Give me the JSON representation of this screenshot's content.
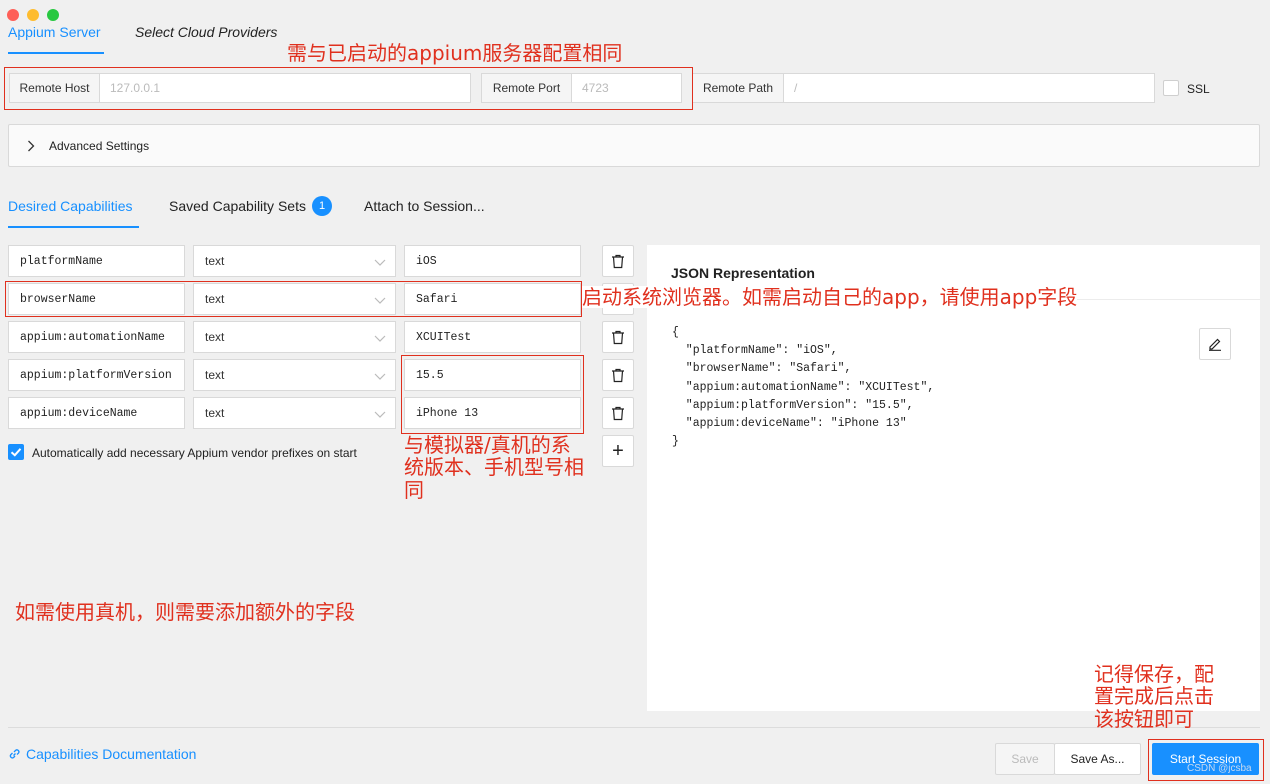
{
  "window": {
    "controls": [
      "close",
      "minimize",
      "maximize"
    ]
  },
  "tabs": {
    "server": "Appium Server",
    "cloud": "Select Cloud Providers"
  },
  "server": {
    "host_label": "Remote Host",
    "host_placeholder": "127.0.0.1",
    "port_label": "Remote Port",
    "port_placeholder": "4723",
    "path_label": "Remote Path",
    "path_placeholder": "/",
    "ssl_label": "SSL"
  },
  "advanced": {
    "label": "Advanced Settings"
  },
  "cap_tabs": {
    "desired": "Desired Capabilities",
    "saved": "Saved Capability Sets",
    "saved_count": "1",
    "attach": "Attach to Session..."
  },
  "capabilities": [
    {
      "name": "platformName",
      "type": "text",
      "value": "iOS"
    },
    {
      "name": "browserName",
      "type": "text",
      "value": "Safari"
    },
    {
      "name": "appium:automationName",
      "type": "text",
      "value": "XCUITest"
    },
    {
      "name": "appium:platformVersion",
      "type": "text",
      "value": "15.5"
    },
    {
      "name": "appium:deviceName",
      "type": "text",
      "value": "iPhone 13"
    }
  ],
  "auto_prefix_label": "Automatically add necessary Appium vendor prefixes on start",
  "json_panel": {
    "title": "JSON Representation",
    "lines": [
      "{",
      "  \"platformName\": \"iOS\",",
      "  \"browserName\": \"Safari\",",
      "  \"appium:automationName\": \"XCUITest\",",
      "  \"appium:platformVersion\": \"15.5\",",
      "  \"appium:deviceName\": \"iPhone 13\"",
      "}"
    ]
  },
  "footer": {
    "docs_link": "Capabilities Documentation",
    "save": "Save",
    "save_as": "Save As...",
    "start": "Start Session",
    "watermark": "CSDN @jcsba"
  },
  "annotations": {
    "server": "需与已启动的appium服务器配置相同",
    "browser_1": "启动系统浏览器。如需启动自己的app，请使用app字段",
    "version_1": "与模拟器/真机的系",
    "version_2": "统版本、手机型号相",
    "version_3": "同",
    "real_device": "如需使用真机，则需要添加额外的字段",
    "save_1": "记得保存，配",
    "save_2": "置完成后点击",
    "save_3": "该按钮即可"
  },
  "colors": {
    "accent": "#1890ff",
    "annotation": "#e0301e"
  }
}
